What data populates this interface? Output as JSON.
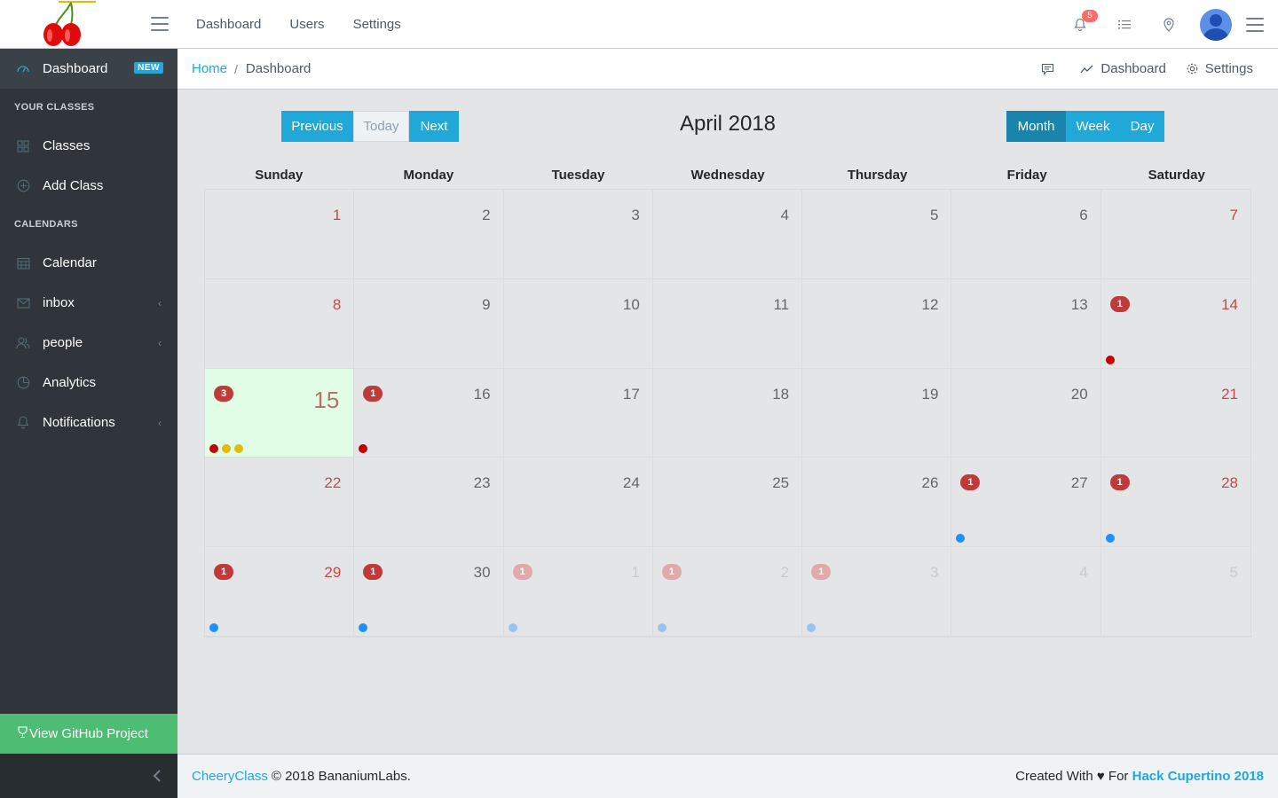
{
  "header": {
    "brand_icon": "cherry-logo",
    "nav": [
      "Dashboard",
      "Users",
      "Settings"
    ],
    "notification_count": "5",
    "colors": {
      "accent": "#20a8d8",
      "danger": "#f86c6b"
    }
  },
  "sidebar": {
    "dashboard": {
      "label": "Dashboard",
      "badge": "NEW"
    },
    "sections": [
      {
        "title": "YOUR CLASSES",
        "items": [
          "Classes",
          "Add Class"
        ]
      },
      {
        "title": "CALENDARS",
        "items": [
          "Calendar",
          "inbox",
          "people",
          "Analytics",
          "Notifications"
        ]
      }
    ],
    "github": "View GitHub Project"
  },
  "breadcrumb": {
    "home": "Home",
    "separator": "/",
    "current": "Dashboard",
    "menu": {
      "dashboard": "Dashboard",
      "settings": "Settings"
    }
  },
  "calendar": {
    "buttons": {
      "previous": "Previous",
      "today": "Today",
      "next": "Next",
      "month": "Month",
      "week": "Week",
      "day": "Day"
    },
    "active_view": "Month",
    "title": "April 2018",
    "weekdays": [
      "Sunday",
      "Monday",
      "Tuesday",
      "Wednesday",
      "Thursday",
      "Friday",
      "Saturday"
    ],
    "weeks": [
      [
        {
          "day": "1"
        },
        {
          "day": "2"
        },
        {
          "day": "3"
        },
        {
          "day": "4"
        },
        {
          "day": "5"
        },
        {
          "day": "6"
        },
        {
          "day": "7"
        }
      ],
      [
        {
          "day": "8"
        },
        {
          "day": "9"
        },
        {
          "day": "10"
        },
        {
          "day": "11"
        },
        {
          "day": "12"
        },
        {
          "day": "13"
        },
        {
          "day": "14",
          "badge": "1",
          "dots": [
            "#c60000"
          ]
        }
      ],
      [
        {
          "day": "15",
          "today": true,
          "badge": "3",
          "dots": [
            "#c60000",
            "#e3bc08",
            "#e3bc08"
          ]
        },
        {
          "day": "16",
          "badge": "1",
          "dots": [
            "#c60000"
          ]
        },
        {
          "day": "17"
        },
        {
          "day": "18"
        },
        {
          "day": "19"
        },
        {
          "day": "20"
        },
        {
          "day": "21"
        }
      ],
      [
        {
          "day": "22"
        },
        {
          "day": "23"
        },
        {
          "day": "24"
        },
        {
          "day": "25"
        },
        {
          "day": "26"
        },
        {
          "day": "27",
          "badge": "1",
          "dots": [
            "#1e90ff"
          ]
        },
        {
          "day": "28",
          "badge": "1",
          "dots": [
            "#1e90ff"
          ]
        }
      ],
      [
        {
          "day": "29",
          "badge": "1",
          "dots": [
            "#1e90ff"
          ]
        },
        {
          "day": "30",
          "badge": "1",
          "dots": [
            "#1e90ff"
          ]
        },
        {
          "day": "1",
          "out": true,
          "badge": "1",
          "dots": [
            "#1e90ff"
          ]
        },
        {
          "day": "2",
          "out": true,
          "badge": "1",
          "dots": [
            "#1e90ff"
          ]
        },
        {
          "day": "3",
          "out": true,
          "badge": "1",
          "dots": [
            "#1e90ff"
          ]
        },
        {
          "day": "4",
          "out": true
        },
        {
          "day": "5",
          "out": true
        }
      ]
    ]
  },
  "footer": {
    "brand_link": "CheeryClass",
    "copyright": "© 2018 BananiumLabs.",
    "created_prefix": "Created With ♥ For",
    "hack_link": "Hack Cupertino 2018"
  }
}
